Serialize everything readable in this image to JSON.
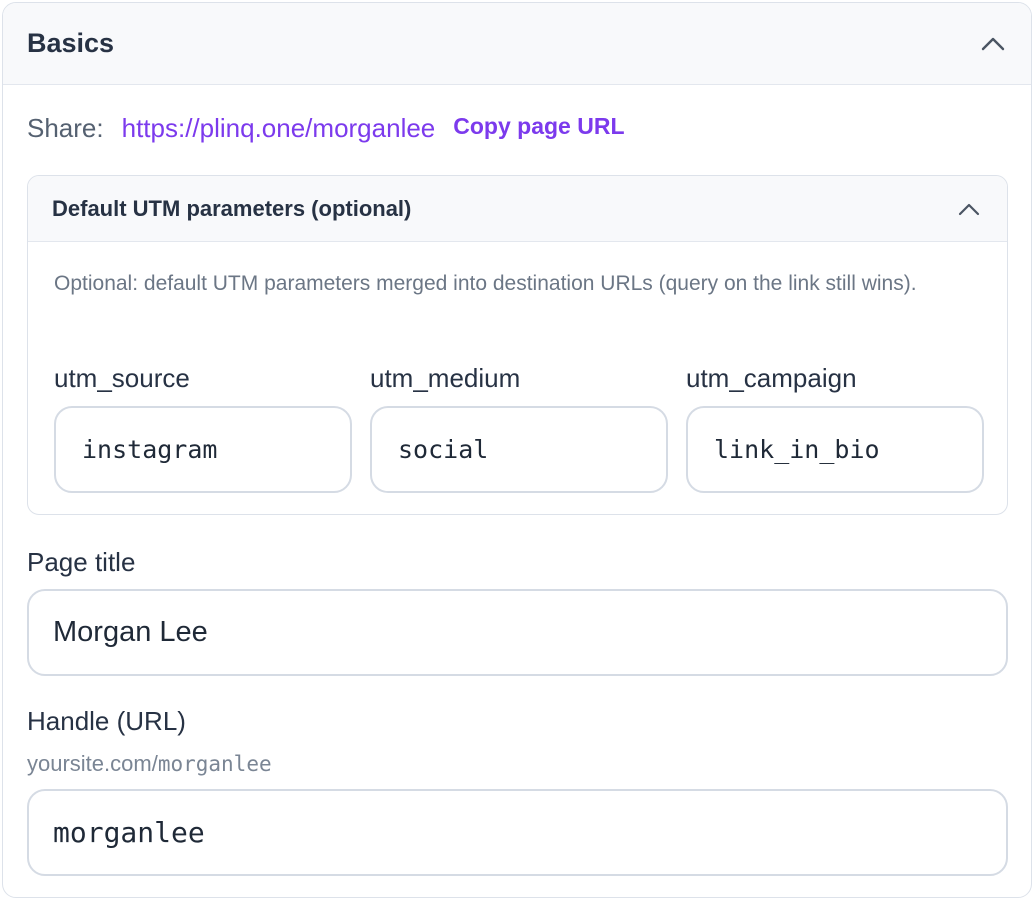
{
  "section": {
    "title": "Basics",
    "toggle_icon": "chevron-up-icon"
  },
  "share": {
    "label": "Share:",
    "url": "https://plinq.one/morganlee",
    "copy_label": "Copy page URL"
  },
  "utm": {
    "title": "Default UTM parameters (optional)",
    "toggle_icon": "chevron-up-icon",
    "description": "Optional: default UTM parameters merged into destination URLs (query on the link still wins).",
    "fields": [
      {
        "label": "utm_source",
        "value": "instagram"
      },
      {
        "label": "utm_medium",
        "value": "social"
      },
      {
        "label": "utm_campaign",
        "value": "link_in_bio"
      }
    ]
  },
  "page_title": {
    "label": "Page title",
    "value": "Morgan Lee"
  },
  "handle": {
    "label": "Handle (URL)",
    "hint_prefix": "yoursite.com/",
    "hint_handle": "morganlee",
    "value": "morganlee"
  },
  "colors": {
    "accent": "#7c3aed",
    "border": "#d5dbe4",
    "header_bg": "#f8f9fb"
  }
}
